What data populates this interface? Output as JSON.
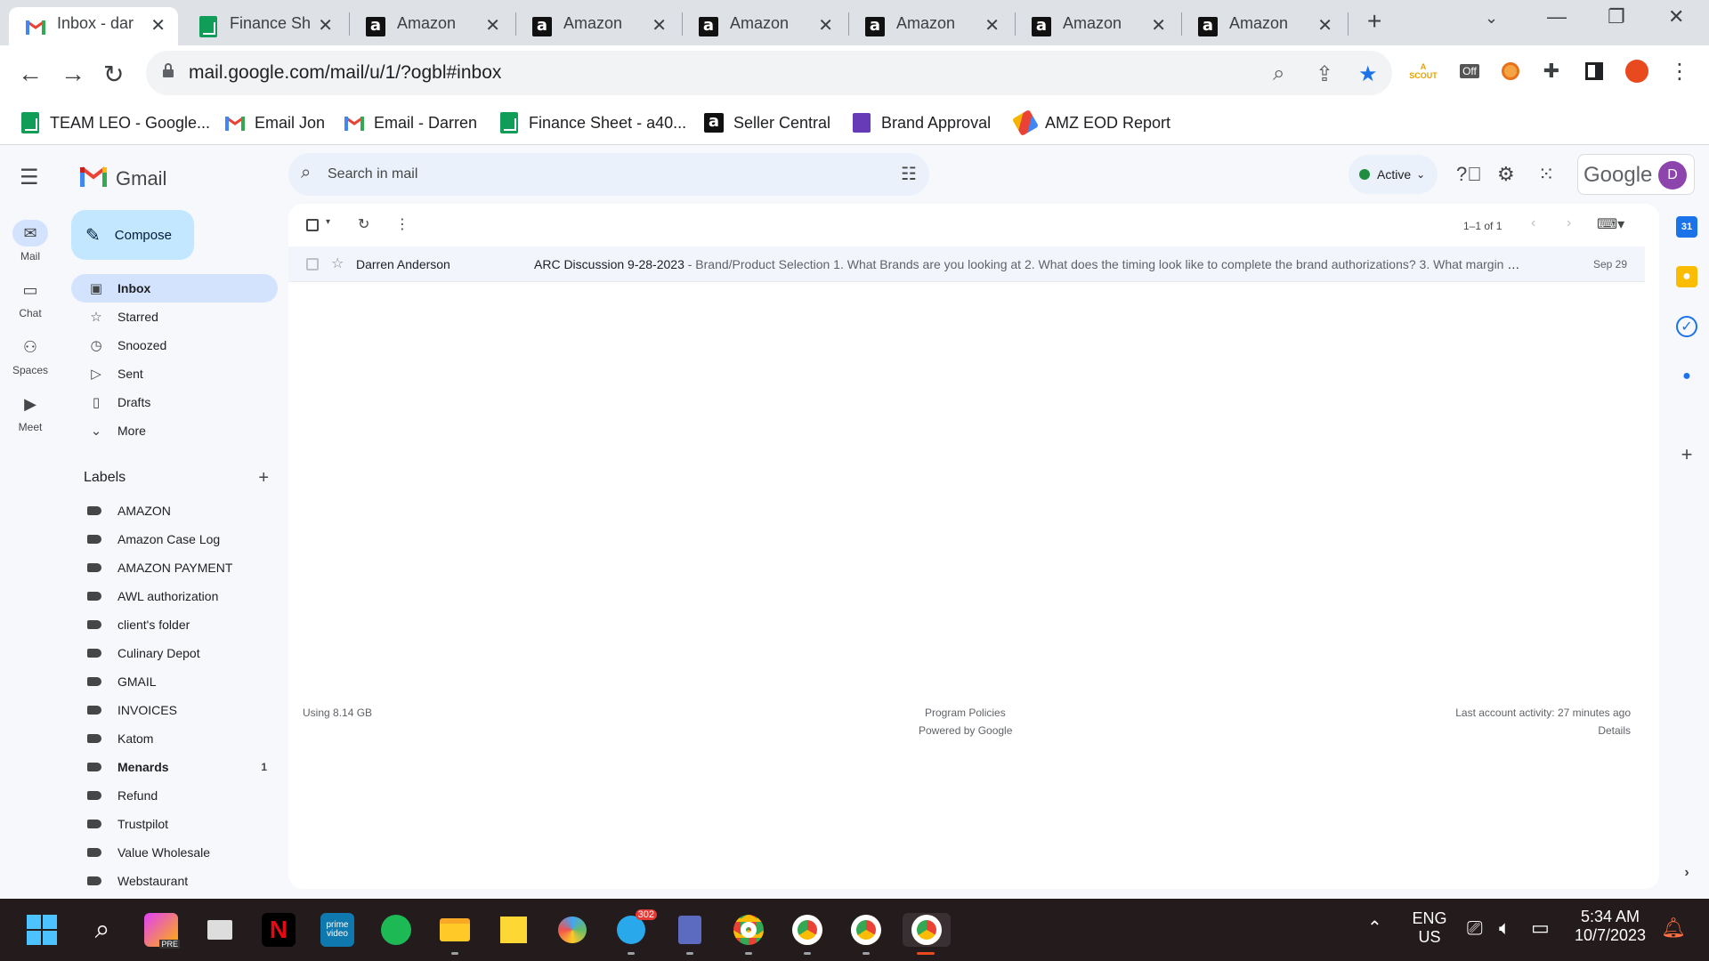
{
  "browser": {
    "tabs": [
      {
        "title": "Inbox - dar",
        "icon": "gmail-icon",
        "active": true
      },
      {
        "title": "Finance Sh",
        "icon": "sheets-icon"
      },
      {
        "title": "Amazon",
        "icon": "amazon-icon"
      },
      {
        "title": "Amazon",
        "icon": "amazon-icon"
      },
      {
        "title": "Amazon",
        "icon": "amazon-icon"
      },
      {
        "title": "Amazon",
        "icon": "amazon-icon"
      },
      {
        "title": "Amazon",
        "icon": "amazon-icon"
      },
      {
        "title": "Amazon",
        "icon": "amazon-icon"
      }
    ],
    "url": "mail.google.com/mail/u/1/?ogbl#inbox",
    "extensions": {
      "off_badge": "Off",
      "scout_label": "SCOUT"
    },
    "bookmarks": [
      {
        "label": "TEAM LEO - Google...",
        "icon": "sheets-icon"
      },
      {
        "label": "Email Jon",
        "icon": "gmail-icon"
      },
      {
        "label": "Email - Darren",
        "icon": "gmail-icon"
      },
      {
        "label": "Finance Sheet - a40...",
        "icon": "sheets-icon"
      },
      {
        "label": "Seller Central",
        "icon": "amazon-icon"
      },
      {
        "label": "Brand Approval",
        "icon": "forms-icon"
      },
      {
        "label": "AMZ EOD Report",
        "icon": "report-icon"
      }
    ]
  },
  "gmail": {
    "app_name": "Gmail",
    "rail": [
      {
        "label": "Mail",
        "active": true
      },
      {
        "label": "Chat"
      },
      {
        "label": "Spaces"
      },
      {
        "label": "Meet"
      }
    ],
    "compose_label": "Compose",
    "nav": [
      {
        "label": "Inbox",
        "active": true
      },
      {
        "label": "Starred"
      },
      {
        "label": "Snoozed"
      },
      {
        "label": "Sent"
      },
      {
        "label": "Drafts"
      },
      {
        "label": "More"
      }
    ],
    "labels_heading": "Labels",
    "labels": [
      {
        "label": "AMAZON"
      },
      {
        "label": "Amazon Case Log"
      },
      {
        "label": "AMAZON PAYMENT"
      },
      {
        "label": "AWL authorization"
      },
      {
        "label": "client's folder"
      },
      {
        "label": "Culinary Depot"
      },
      {
        "label": "GMAIL"
      },
      {
        "label": "INVOICES"
      },
      {
        "label": "Katom"
      },
      {
        "label": "Menards",
        "count": "1",
        "bold": true
      },
      {
        "label": "Refund"
      },
      {
        "label": "Trustpilot"
      },
      {
        "label": "Value Wholesale"
      },
      {
        "label": "Webstaurant"
      }
    ],
    "search_placeholder": "Search in mail",
    "status": "Active",
    "account_brand": "Google",
    "avatar_letter": "D",
    "pager_text": "1–1 of 1",
    "emails": [
      {
        "sender": "Darren Anderson",
        "subject": "ARC Discussion 9-28-2023",
        "snippet": " - Brand/Product Selection 1. What Brands are you looking at 2. What does the timing look like to complete the brand authorizations? 3. What margin ra...",
        "date": "Sep 29"
      }
    ],
    "footer": {
      "storage": "Using 8.14 GB",
      "policies": "Program Policies",
      "powered": "Powered by Google",
      "activity": "Last account activity: 27 minutes ago",
      "details": "Details"
    }
  },
  "taskbar": {
    "telegram_badge": "302",
    "lang_line1": "ENG",
    "lang_line2": "US",
    "time": "5:34 AM",
    "date": "10/7/2023",
    "prime_label": "prime video",
    "pre_badge": "PRE"
  },
  "colors": {
    "accent": "#0b57d0",
    "compose_bg": "#c2e7ff",
    "active_nav": "#d3e3fd",
    "status_green": "#1e8e3e"
  }
}
